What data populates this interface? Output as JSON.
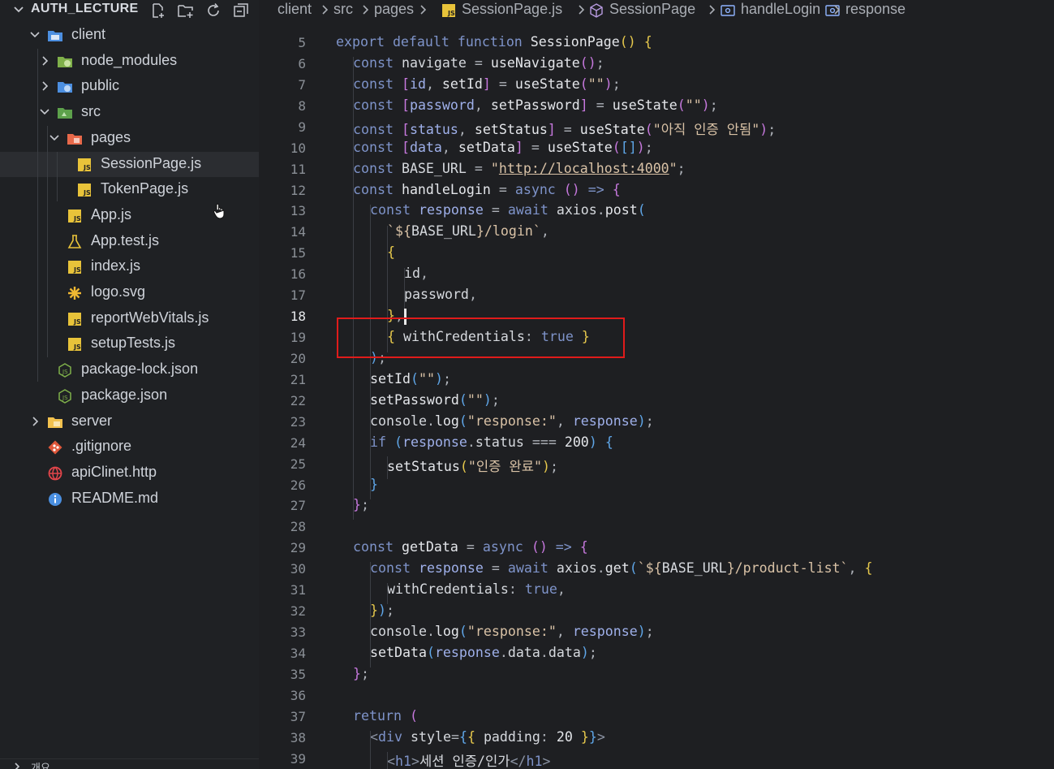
{
  "explorer": {
    "title": "AUTH_LECTURE",
    "actions": [
      "new-file-icon",
      "new-folder-icon",
      "refresh-icon",
      "collapse-all-icon"
    ],
    "tree": [
      {
        "label": "client",
        "kind": "folder",
        "icon": "folder-client-icon",
        "expanded": true,
        "depth": 0
      },
      {
        "label": "node_modules",
        "kind": "folder",
        "icon": "folder-node-icon",
        "expanded": false,
        "depth": 1
      },
      {
        "label": "public",
        "kind": "folder",
        "icon": "folder-public-icon",
        "expanded": false,
        "depth": 1
      },
      {
        "label": "src",
        "kind": "folder",
        "icon": "folder-src-icon",
        "expanded": true,
        "depth": 1
      },
      {
        "label": "pages",
        "kind": "folder",
        "icon": "folder-pages-icon",
        "expanded": true,
        "depth": 2
      },
      {
        "label": "SessionPage.js",
        "kind": "file",
        "icon": "js-file-icon",
        "depth": 3,
        "selected": true
      },
      {
        "label": "TokenPage.js",
        "kind": "file",
        "icon": "js-file-icon",
        "depth": 3
      },
      {
        "label": "App.js",
        "kind": "file",
        "icon": "js-file-icon",
        "depth": 2
      },
      {
        "label": "App.test.js",
        "kind": "file",
        "icon": "test-flask-icon",
        "depth": 2
      },
      {
        "label": "index.js",
        "kind": "file",
        "icon": "js-file-icon",
        "depth": 2
      },
      {
        "label": "logo.svg",
        "kind": "file",
        "icon": "svg-file-icon",
        "depth": 2
      },
      {
        "label": "reportWebVitals.js",
        "kind": "file",
        "icon": "js-file-icon",
        "depth": 2
      },
      {
        "label": "setupTests.js",
        "kind": "file",
        "icon": "js-file-icon",
        "depth": 2
      },
      {
        "label": "package-lock.json",
        "kind": "file",
        "icon": "nodejs-json-icon",
        "depth": 1
      },
      {
        "label": "package.json",
        "kind": "file",
        "icon": "nodejs-json-icon",
        "depth": 1
      },
      {
        "label": "server",
        "kind": "folder",
        "icon": "folder-server-icon",
        "expanded": false,
        "depth": 0
      },
      {
        "label": ".gitignore",
        "kind": "file",
        "icon": "git-icon",
        "depth": 0
      },
      {
        "label": "apiClinet.http",
        "kind": "file",
        "icon": "globe-icon",
        "depth": 0
      },
      {
        "label": "README.md",
        "kind": "file",
        "icon": "info-icon",
        "depth": 0
      }
    ],
    "bottom_section": "개요"
  },
  "breadcrumb": {
    "items": [
      "client",
      "src",
      "pages",
      "SessionPage.js",
      "SessionPage",
      "handleLogin",
      "response"
    ],
    "icons": [
      "",
      "",
      "",
      "js-file-icon",
      "cube-icon",
      "variable-icon",
      "variable-icon"
    ]
  },
  "editor": {
    "active_line": 18,
    "lines": [
      {
        "n": 5,
        "indent": 0,
        "tokens": [
          [
            "kw",
            "export "
          ],
          [
            "kw",
            "default "
          ],
          [
            "kw",
            "function "
          ],
          [
            "fn",
            "SessionPage"
          ],
          [
            "br1",
            "()"
          ],
          [
            "pu",
            " "
          ],
          [
            "br1",
            "{"
          ]
        ]
      },
      {
        "n": 6,
        "indent": 1,
        "tokens": [
          [
            "kw",
            "const "
          ],
          [
            "vr",
            "navigate"
          ],
          [
            "pu",
            " = "
          ],
          [
            "fn",
            "useNavigate"
          ],
          [
            "br2",
            "()"
          ],
          [
            "pu",
            ";"
          ]
        ]
      },
      {
        "n": 7,
        "indent": 1,
        "tokens": [
          [
            "kw",
            "const "
          ],
          [
            "br2",
            "["
          ],
          [
            "pm",
            "id"
          ],
          [
            "pu",
            ", "
          ],
          [
            "fn",
            "setId"
          ],
          [
            "br2",
            "]"
          ],
          [
            "pu",
            " = "
          ],
          [
            "fn",
            "useState"
          ],
          [
            "br2",
            "("
          ],
          [
            "st",
            "\"\""
          ],
          [
            "br2",
            ")"
          ],
          [
            "pu",
            ";"
          ]
        ]
      },
      {
        "n": 8,
        "indent": 1,
        "tokens": [
          [
            "kw",
            "const "
          ],
          [
            "br2",
            "["
          ],
          [
            "pm",
            "password"
          ],
          [
            "pu",
            ", "
          ],
          [
            "fn",
            "setPassword"
          ],
          [
            "br2",
            "]"
          ],
          [
            "pu",
            " = "
          ],
          [
            "fn",
            "useState"
          ],
          [
            "br2",
            "("
          ],
          [
            "st",
            "\"\""
          ],
          [
            "br2",
            ")"
          ],
          [
            "pu",
            ";"
          ]
        ]
      },
      {
        "n": 9,
        "indent": 1,
        "tokens": [
          [
            "kw",
            "const "
          ],
          [
            "br2",
            "["
          ],
          [
            "pm",
            "status"
          ],
          [
            "pu",
            ", "
          ],
          [
            "fn",
            "setStatus"
          ],
          [
            "br2",
            "]"
          ],
          [
            "pu",
            " = "
          ],
          [
            "fn",
            "useState"
          ],
          [
            "br2",
            "("
          ],
          [
            "st",
            "\"아직 인증 안됨\""
          ],
          [
            "br2",
            ")"
          ],
          [
            "pu",
            ";"
          ]
        ]
      },
      {
        "n": 10,
        "indent": 1,
        "tokens": [
          [
            "kw",
            "const "
          ],
          [
            "br2",
            "["
          ],
          [
            "pm",
            "data"
          ],
          [
            "pu",
            ", "
          ],
          [
            "fn",
            "setData"
          ],
          [
            "br2",
            "]"
          ],
          [
            "pu",
            " = "
          ],
          [
            "fn",
            "useState"
          ],
          [
            "br2",
            "("
          ],
          [
            "br3",
            "[]"
          ],
          [
            "br2",
            ")"
          ],
          [
            "pu",
            ";"
          ]
        ]
      },
      {
        "n": 11,
        "indent": 1,
        "tokens": [
          [
            "kw",
            "const "
          ],
          [
            "vr",
            "BASE_URL"
          ],
          [
            "pu",
            " = "
          ],
          [
            "st",
            "\""
          ],
          [
            "url",
            "http://localhost:4000"
          ],
          [
            "st",
            "\""
          ],
          [
            "pu",
            ";"
          ]
        ]
      },
      {
        "n": 12,
        "indent": 1,
        "tokens": [
          [
            "kw",
            "const "
          ],
          [
            "fn",
            "handleLogin"
          ],
          [
            "pu",
            " = "
          ],
          [
            "kw",
            "async "
          ],
          [
            "br2",
            "()"
          ],
          [
            "kw",
            " => "
          ],
          [
            "br2",
            "{"
          ]
        ]
      },
      {
        "n": 13,
        "indent": 2,
        "tokens": [
          [
            "kw",
            "const "
          ],
          [
            "pm",
            "response"
          ],
          [
            "pu",
            " = "
          ],
          [
            "kw",
            "await "
          ],
          [
            "vr",
            "axios"
          ],
          [
            "pu",
            "."
          ],
          [
            "fn",
            "post"
          ],
          [
            "br3",
            "("
          ]
        ]
      },
      {
        "n": 14,
        "indent": 3,
        "tokens": [
          [
            "st",
            "`${"
          ],
          [
            "vr",
            "BASE_URL"
          ],
          [
            "st",
            "}/login`"
          ],
          [
            "pu",
            ","
          ]
        ]
      },
      {
        "n": 15,
        "indent": 3,
        "tokens": [
          [
            "br1",
            "{"
          ]
        ]
      },
      {
        "n": 16,
        "indent": 4,
        "tokens": [
          [
            "vr",
            "id"
          ],
          [
            "pu",
            ","
          ]
        ]
      },
      {
        "n": 17,
        "indent": 4,
        "tokens": [
          [
            "vr",
            "password"
          ],
          [
            "pu",
            ","
          ]
        ]
      },
      {
        "n": 18,
        "indent": 3,
        "tokens": [
          [
            "br1",
            "}"
          ],
          [
            "pu",
            ","
          ]
        ]
      },
      {
        "n": 19,
        "indent": 3,
        "tokens": [
          [
            "br1",
            "{"
          ],
          [
            "pu",
            " "
          ],
          [
            "vr",
            "withCredentials"
          ],
          [
            "pu",
            ": "
          ],
          [
            "bool",
            "true"
          ],
          [
            "pu",
            " "
          ],
          [
            "br1",
            "}"
          ]
        ]
      },
      {
        "n": 20,
        "indent": 2,
        "tokens": [
          [
            "br3",
            ")"
          ],
          [
            "pu",
            ";"
          ]
        ]
      },
      {
        "n": 21,
        "indent": 2,
        "tokens": [
          [
            "fn",
            "setId"
          ],
          [
            "br3",
            "("
          ],
          [
            "st",
            "\"\""
          ],
          [
            "br3",
            ")"
          ],
          [
            "pu",
            ";"
          ]
        ]
      },
      {
        "n": 22,
        "indent": 2,
        "tokens": [
          [
            "fn",
            "setPassword"
          ],
          [
            "br3",
            "("
          ],
          [
            "st",
            "\"\""
          ],
          [
            "br3",
            ")"
          ],
          [
            "pu",
            ";"
          ]
        ]
      },
      {
        "n": 23,
        "indent": 2,
        "tokens": [
          [
            "vr",
            "console"
          ],
          [
            "pu",
            "."
          ],
          [
            "fn",
            "log"
          ],
          [
            "br3",
            "("
          ],
          [
            "st",
            "\"response:\""
          ],
          [
            "pu",
            ", "
          ],
          [
            "pm",
            "response"
          ],
          [
            "br3",
            ")"
          ],
          [
            "pu",
            ";"
          ]
        ]
      },
      {
        "n": 24,
        "indent": 2,
        "tokens": [
          [
            "ctrl",
            "if "
          ],
          [
            "br3",
            "("
          ],
          [
            "pm",
            "response"
          ],
          [
            "pu",
            "."
          ],
          [
            "vr",
            "status"
          ],
          [
            "pu",
            " === "
          ],
          [
            "num",
            "200"
          ],
          [
            "br3",
            ")"
          ],
          [
            "pu",
            " "
          ],
          [
            "br3",
            "{"
          ]
        ]
      },
      {
        "n": 25,
        "indent": 3,
        "tokens": [
          [
            "fn",
            "setStatus"
          ],
          [
            "br1",
            "("
          ],
          [
            "st",
            "\"인증 완료\""
          ],
          [
            "br1",
            ")"
          ],
          [
            "pu",
            ";"
          ]
        ]
      },
      {
        "n": 26,
        "indent": 2,
        "tokens": [
          [
            "br3",
            "}"
          ]
        ]
      },
      {
        "n": 27,
        "indent": 1,
        "tokens": [
          [
            "br2",
            "}"
          ],
          [
            "pu",
            ";"
          ]
        ]
      },
      {
        "n": 28,
        "indent": 0,
        "tokens": []
      },
      {
        "n": 29,
        "indent": 1,
        "tokens": [
          [
            "kw",
            "const "
          ],
          [
            "fn",
            "getData"
          ],
          [
            "pu",
            " = "
          ],
          [
            "kw",
            "async "
          ],
          [
            "br2",
            "()"
          ],
          [
            "kw",
            " => "
          ],
          [
            "br2",
            "{"
          ]
        ]
      },
      {
        "n": 30,
        "indent": 2,
        "tokens": [
          [
            "kw",
            "const "
          ],
          [
            "pm",
            "response"
          ],
          [
            "pu",
            " = "
          ],
          [
            "kw",
            "await "
          ],
          [
            "vr",
            "axios"
          ],
          [
            "pu",
            "."
          ],
          [
            "fn",
            "get"
          ],
          [
            "br3",
            "("
          ],
          [
            "st",
            "`${"
          ],
          [
            "vr",
            "BASE_URL"
          ],
          [
            "st",
            "}/product-list`"
          ],
          [
            "pu",
            ", "
          ],
          [
            "br1",
            "{"
          ]
        ]
      },
      {
        "n": 31,
        "indent": 3,
        "tokens": [
          [
            "vr",
            "withCredentials"
          ],
          [
            "pu",
            ": "
          ],
          [
            "bool",
            "true"
          ],
          [
            "pu",
            ","
          ]
        ]
      },
      {
        "n": 32,
        "indent": 2,
        "tokens": [
          [
            "br1",
            "}"
          ],
          [
            "br3",
            ")"
          ],
          [
            "pu",
            ";"
          ]
        ]
      },
      {
        "n": 33,
        "indent": 2,
        "tokens": [
          [
            "vr",
            "console"
          ],
          [
            "pu",
            "."
          ],
          [
            "fn",
            "log"
          ],
          [
            "br3",
            "("
          ],
          [
            "st",
            "\"response:\""
          ],
          [
            "pu",
            ", "
          ],
          [
            "pm",
            "response"
          ],
          [
            "br3",
            ")"
          ],
          [
            "pu",
            ";"
          ]
        ]
      },
      {
        "n": 34,
        "indent": 2,
        "tokens": [
          [
            "fn",
            "setData"
          ],
          [
            "br3",
            "("
          ],
          [
            "pm",
            "response"
          ],
          [
            "pu",
            "."
          ],
          [
            "vr",
            "data"
          ],
          [
            "pu",
            "."
          ],
          [
            "vr",
            "data"
          ],
          [
            "br3",
            ")"
          ],
          [
            "pu",
            ";"
          ]
        ]
      },
      {
        "n": 35,
        "indent": 1,
        "tokens": [
          [
            "br2",
            "}"
          ],
          [
            "pu",
            ";"
          ]
        ]
      },
      {
        "n": 36,
        "indent": 0,
        "tokens": []
      },
      {
        "n": 37,
        "indent": 1,
        "tokens": [
          [
            "ctrl",
            "return "
          ],
          [
            "br2",
            "("
          ]
        ]
      },
      {
        "n": 38,
        "indent": 2,
        "tokens": [
          [
            "tg",
            "<"
          ],
          [
            "kw",
            "div"
          ],
          [
            "pu",
            " "
          ],
          [
            "vr",
            "style"
          ],
          [
            "pu",
            "="
          ],
          [
            "br3",
            "{"
          ],
          [
            "br1",
            "{"
          ],
          [
            "pu",
            " "
          ],
          [
            "vr",
            "padding"
          ],
          [
            "pu",
            ": "
          ],
          [
            "num",
            "20"
          ],
          [
            "pu",
            " "
          ],
          [
            "br1",
            "}"
          ],
          [
            "br3",
            "}"
          ],
          [
            "tg",
            ">"
          ]
        ]
      },
      {
        "n": 39,
        "indent": 3,
        "tokens": [
          [
            "tg",
            "<"
          ],
          [
            "kw",
            "h1"
          ],
          [
            "tg",
            ">"
          ],
          [
            "vr",
            "세션 인증/인가"
          ],
          [
            "tg",
            "</"
          ],
          [
            "kw",
            "h1"
          ],
          [
            "tg",
            ">"
          ]
        ]
      }
    ]
  },
  "highlight": {
    "color": "#e01b1b",
    "line": 19
  },
  "colors": {
    "cursor": "#e8e8e8",
    "selection": "#2b2d31"
  }
}
